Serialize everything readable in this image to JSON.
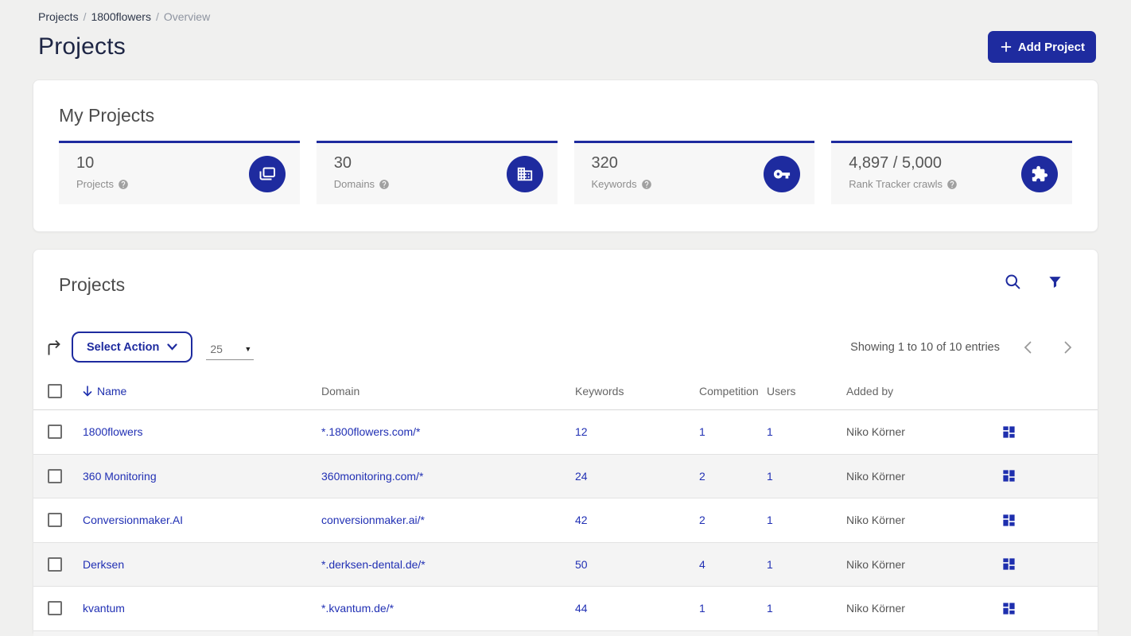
{
  "breadcrumb": {
    "items": [
      {
        "label": "Projects"
      },
      {
        "label": "1800flowers"
      },
      {
        "label": "Overview"
      }
    ],
    "separator": "/"
  },
  "header": {
    "title": "Projects",
    "add_button": "Add Project"
  },
  "stats_card": {
    "title": "My Projects",
    "tiles": [
      {
        "value": "10",
        "label": "Projects",
        "icon": "projects-copy-icon"
      },
      {
        "value": "30",
        "label": "Domains",
        "icon": "building-icon"
      },
      {
        "value": "320",
        "label": "Keywords",
        "icon": "key-icon"
      },
      {
        "value": "4,897 / 5,000",
        "label": "Rank Tracker crawls",
        "icon": "puzzle-icon"
      }
    ]
  },
  "projects_card": {
    "title": "Projects",
    "toolbar": {
      "select_action_label": "Select Action",
      "page_size": "25",
      "showing_text": "Showing 1 to 10 of 10 entries"
    },
    "table": {
      "columns": {
        "name": "Name",
        "domain": "Domain",
        "keywords": "Keywords",
        "competition": "Competition",
        "users": "Users",
        "added_by": "Added by"
      },
      "rows": [
        {
          "name": "1800flowers",
          "domain": "*.1800flowers.com/*",
          "keywords": "12",
          "competition": "1",
          "users": "1",
          "added_by": "Niko Körner"
        },
        {
          "name": "360 Monitoring",
          "domain": "360monitoring.com/*",
          "keywords": "24",
          "competition": "2",
          "users": "1",
          "added_by": "Niko Körner"
        },
        {
          "name": "Conversionmaker.AI",
          "domain": "conversionmaker.ai/*",
          "keywords": "42",
          "competition": "2",
          "users": "1",
          "added_by": "Niko Körner"
        },
        {
          "name": "Derksen",
          "domain": "*.derksen-dental.de/*",
          "keywords": "50",
          "competition": "4",
          "users": "1",
          "added_by": "Niko Körner"
        },
        {
          "name": "kvantum",
          "domain": "*.kvantum.de/*",
          "keywords": "44",
          "competition": "1",
          "users": "1",
          "added_by": "Niko Körner"
        }
      ]
    }
  },
  "colors": {
    "primary": "#1e2b9f",
    "link_blue": "#2130b4",
    "page_background": "#f0f0ef"
  }
}
